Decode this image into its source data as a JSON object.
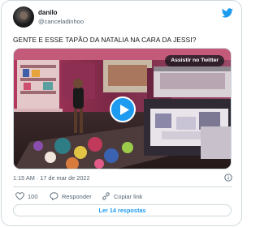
{
  "user": {
    "display_name": "danilo",
    "handle": "@canceladinhoo"
  },
  "tweet": {
    "text": "GENTE E ESSE TAPÃO DA NATALIA NA CARA DA JESSI?",
    "timestamp": "1:15 AM · 17 de mar de 2022"
  },
  "media": {
    "watch_label": "Assistir no Twitter",
    "play_icon": "play-icon"
  },
  "actions": {
    "like_count": "100",
    "reply_label": "Responder",
    "copy_label": "Copiar link"
  },
  "footer": {
    "read_replies_label": "Ler 14 respostas"
  },
  "colors": {
    "accent": "#1d9bf0",
    "border": "#cfd9de",
    "muted": "#536471"
  }
}
